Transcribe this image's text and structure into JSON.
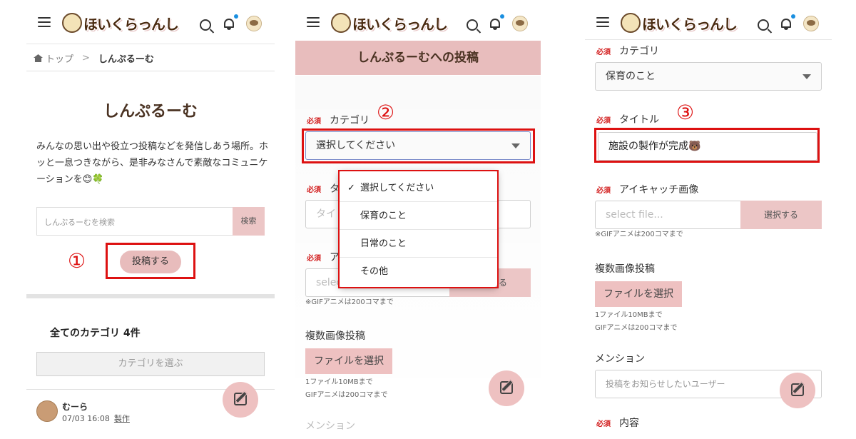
{
  "app": {
    "logo_text": "ほいくらっんし"
  },
  "panel1": {
    "breadcrumb": {
      "home": "トップ",
      "sep": ">",
      "current": "しんぷるーむ"
    },
    "title": "しんぷるーむ",
    "description": "みんなの思い出や役立つ投稿などを発信しあう場所。ホッと一息つきながら、是非みなさんで素敵なコミュニケーションを😊🍀",
    "search": {
      "placeholder": "しんぷるーむを検索",
      "button": "検索"
    },
    "post_button": "投稿する",
    "step": "①",
    "category_count": "全てのカテゴリ 4件",
    "category_select": "カテゴリを選ぶ",
    "post": {
      "user": "むーら",
      "date": "07/03 16:08",
      "tag": "製作"
    }
  },
  "panel2": {
    "title": "しんぷるーむへの投稿",
    "step": "②",
    "required": "必須",
    "category_label": "カテゴリ",
    "category_value": "選択してください",
    "title_label_partial": "タ",
    "title_placeholder_partial": "タイ",
    "eyecatch_label_partial": "ア",
    "file_placeholder_partial": "select file...",
    "file_button_partial": "選択する",
    "gif_note": "※GIFアニメは200コマまで",
    "multi_label": "複数画像投稿",
    "multi_button": "ファイルを選択",
    "multi_note1": "1ファイル10MBまで",
    "multi_note2": "GIFアニメは200コマまで",
    "mention_partial": "メンション",
    "options": [
      {
        "label": "選択してください",
        "check": "✓"
      },
      {
        "label": "保育のこと",
        "check": ""
      },
      {
        "label": "日常のこと",
        "check": ""
      },
      {
        "label": "その他",
        "check": ""
      }
    ]
  },
  "panel3": {
    "step": "③",
    "required": "必須",
    "category_label": "カテゴリ",
    "category_value": "保育のこと",
    "title_label": "タイトル",
    "title_value": "施設の製作が完成🐻",
    "eyecatch_label": "アイキャッチ画像",
    "file_placeholder": "select file...",
    "file_button": "選択する",
    "gif_note": "※GIFアニメは200コマまで",
    "multi_label": "複数画像投稿",
    "multi_button": "ファイルを選択",
    "multi_note1": "1ファイル10MBまで",
    "multi_note2": "GIFアニメは200コマまで",
    "mention_label": "メンション",
    "mention_placeholder": "投稿をお知らせしたいユーザー",
    "content_label": "内容"
  },
  "colors": {
    "accent_pink": "#e8bdbd",
    "highlight_red": "#dd1111",
    "required_red": "#d32020",
    "notification_blue": "#1a8fe0"
  }
}
